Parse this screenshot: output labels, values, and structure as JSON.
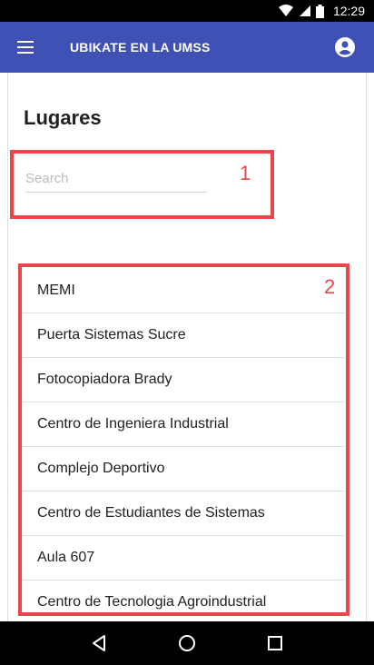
{
  "status_bar": {
    "time": "12:29",
    "icons": [
      "wifi-icon",
      "signal-icon",
      "battery-icon"
    ]
  },
  "app_bar": {
    "title": "UBIKATE EN LA UMSS",
    "menu_icon": "hamburger-menu-icon",
    "account_icon": "account-circle-icon",
    "color": "#3f51b5"
  },
  "page": {
    "title": "Lugares"
  },
  "search": {
    "placeholder": "Search",
    "value": ""
  },
  "annotations": {
    "search_label": "1",
    "list_label": "2",
    "color": "#e8474a"
  },
  "places": [
    "MEMI",
    "Puerta Sistemas Sucre",
    "Fotocopiadora Brady",
    "Centro de Ingeniera Industrial",
    "Complejo Deportivo",
    "Centro de Estudiantes de Sistemas",
    "Aula 607",
    "Centro de Tecnologia Agroindustrial"
  ],
  "nav_bar": {
    "buttons": [
      "back-icon",
      "home-icon",
      "recents-icon"
    ]
  }
}
